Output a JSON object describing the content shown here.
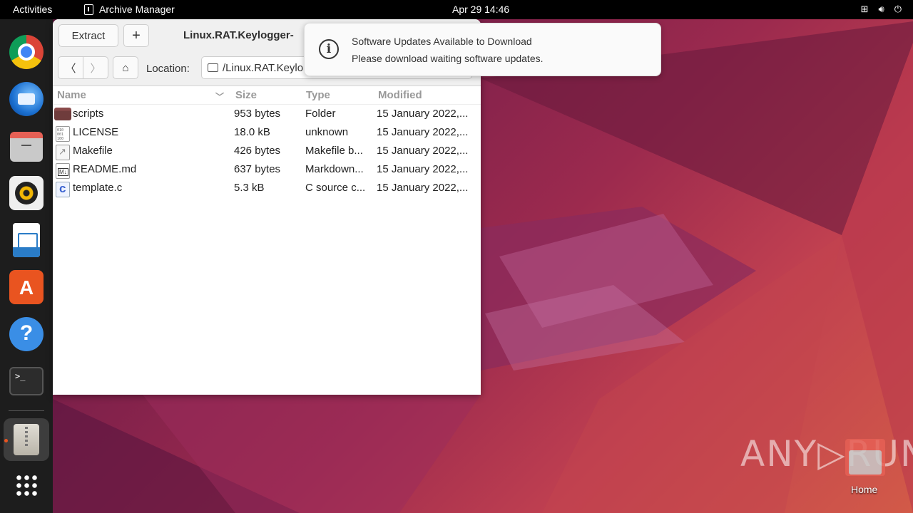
{
  "topbar": {
    "activities": "Activities",
    "app_name": "Archive Manager",
    "clock": "Apr 29  14:46",
    "tray_icons": [
      "network-icon",
      "volume-icon",
      "power-icon"
    ]
  },
  "dock": {
    "apps": [
      "Google Chrome",
      "Thunderbird",
      "Files",
      "Rhythmbox",
      "LibreOffice Writer",
      "Ubuntu Software",
      "Help",
      "Terminal",
      "Archive Manager",
      "Show Applications"
    ]
  },
  "window": {
    "extract_label": "Extract",
    "add_label": "+",
    "title": "Linux.RAT.Keylogger-",
    "location_label": "Location:",
    "location_value": "/Linux.RAT.Keylo",
    "columns": {
      "name": "Name",
      "size": "Size",
      "type": "Type",
      "modified": "Modified"
    },
    "files": [
      {
        "name": "scripts",
        "size": "953 bytes",
        "type": "Folder",
        "modified": "15 January 2022,...",
        "icon": "folder-icon"
      },
      {
        "name": "LICENSE",
        "size": "18.0 kB",
        "type": "unknown",
        "modified": "15 January 2022,...",
        "icon": "binary-file-icon"
      },
      {
        "name": "Makefile",
        "size": "426 bytes",
        "type": "Makefile b...",
        "modified": "15 January 2022,...",
        "icon": "makefile-icon"
      },
      {
        "name": "README.md",
        "size": "637 bytes",
        "type": "Markdown...",
        "modified": "15 January 2022,...",
        "icon": "markdown-file-icon"
      },
      {
        "name": "template.c",
        "size": "5.3 kB",
        "type": "C source c...",
        "modified": "15 January 2022,...",
        "icon": "c-source-file-icon"
      }
    ]
  },
  "notification": {
    "title": "Software Updates Available to Download",
    "body": "Please download waiting software updates."
  },
  "desktop": {
    "home_label": "Home",
    "watermark": "ANY▷RUN"
  }
}
